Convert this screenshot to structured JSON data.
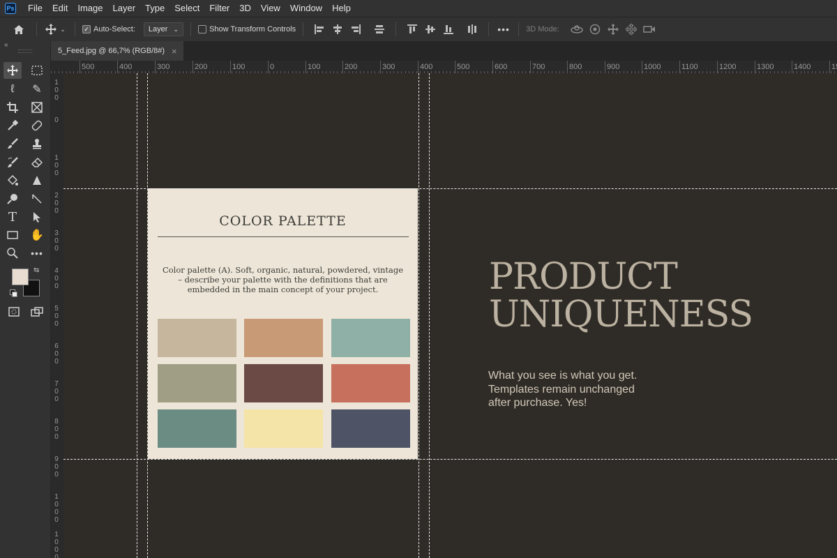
{
  "app": {
    "logo": "Ps"
  },
  "menu": [
    "File",
    "Edit",
    "Image",
    "Layer",
    "Type",
    "Select",
    "Filter",
    "3D",
    "View",
    "Window",
    "Help"
  ],
  "options": {
    "auto_select_label": "Auto-Select:",
    "auto_select_target": "Layer",
    "show_transform_label": "Show Transform Controls",
    "mode_3d_label": "3D Mode:"
  },
  "document": {
    "tab_title": "5_Feed.jpg @ 66,7% (RGB/8#)",
    "close_glyph": "×"
  },
  "hruler_labels": [
    "500",
    "400",
    "300",
    "200",
    "100",
    "0",
    "100",
    "200",
    "300",
    "400",
    "500",
    "600",
    "700",
    "800",
    "900",
    "1000",
    "1100",
    "1200",
    "1300",
    "1400",
    "15"
  ],
  "vruler_labels": [
    "1",
    "0",
    "1",
    "2",
    "3",
    "4",
    "5",
    "6",
    "7",
    "8",
    "9",
    "1",
    "1"
  ],
  "vruler_sublabels": [
    "00",
    "",
    "00",
    "00",
    "00",
    "00",
    "00",
    "00",
    "00",
    "00",
    "00",
    "000",
    "000"
  ],
  "colors": {
    "foreground": "#e8ddd0",
    "background": "#111111",
    "canvas_bg": "#2f2c28",
    "card_bg": "#ede6d8",
    "title_color": "#bcb2a1"
  },
  "card": {
    "title": "COLOR PALETTE",
    "description": "Color palette (A). Soft, organic, natural, powdered, vintage – describe your palette with the definitions that are embedded in the main concept of your project.",
    "swatches": [
      "#c6b69d",
      "#c99a76",
      "#8fb0a6",
      "#a09f85",
      "#6b4a46",
      "#c7705e",
      "#6a8c82",
      "#f4e4a8",
      "#4e5466"
    ]
  },
  "headline": {
    "line1": "PRODUCT",
    "line2": "UNIQUENESS"
  },
  "subtext": {
    "line1": "What you see is what you get.",
    "line2": "Templates remain unchanged",
    "line3": "after purchase. Yes!"
  }
}
